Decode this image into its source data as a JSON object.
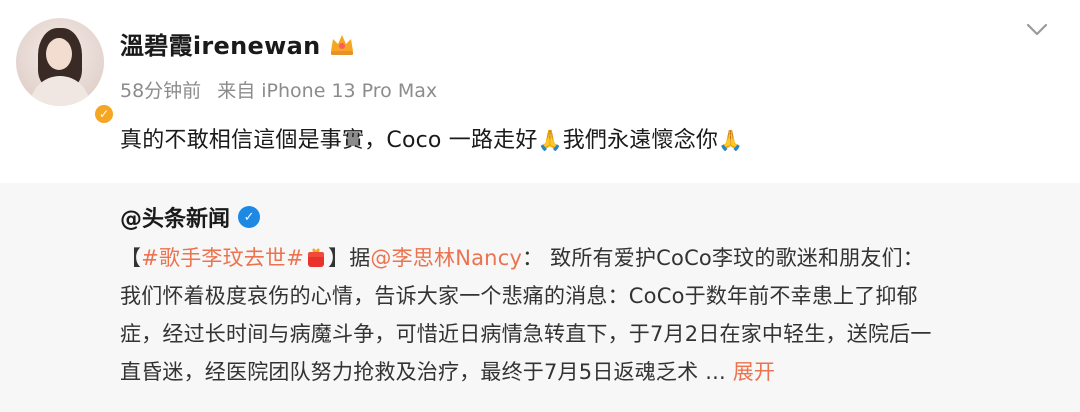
{
  "post": {
    "username": "溫碧霞irenewan",
    "time": "58分钟前",
    "source": "来自 iPhone 13 Pro Max",
    "text_part1": "真的不敢相信這個是事實，Coco 一路走好",
    "pray_emoji": "🙏",
    "text_part2": "我們永遠懷念你",
    "pray_emoji_2": "🙏"
  },
  "repost": {
    "author": "@头条新闻",
    "hashtag_open": "【",
    "hashtag": "#歌手李玟去世#",
    "hashtag_close": "】",
    "according": "据",
    "mention": "@李思林Nancy",
    "line1_rest": "： 致所有爱护CoCo李玟的歌迷和朋友们：",
    "line2": "我们怀着极度哀伤的心情，告诉大家一个悲痛的消息：CoCo于数年前不幸患上了抑郁",
    "line3": "症，经过长时间与病魔斗争，可惜近日病情急转直下，于7月2日在家中轻生，送院后一",
    "line4": "直昏迷，经医院团队努力抢救及治疗，最终于7月5日返魂乏术",
    "ellipsis": " ...",
    "expand": "展开"
  },
  "colors": {
    "link": "#eb7350",
    "repost_bg": "#f7f7f7",
    "verified_blue": "#1e88e5",
    "verified_gold": "#f5a623"
  },
  "icons": {
    "more": "chevron-down-icon",
    "crown": "crown-icon",
    "topic": "gift-icon"
  }
}
